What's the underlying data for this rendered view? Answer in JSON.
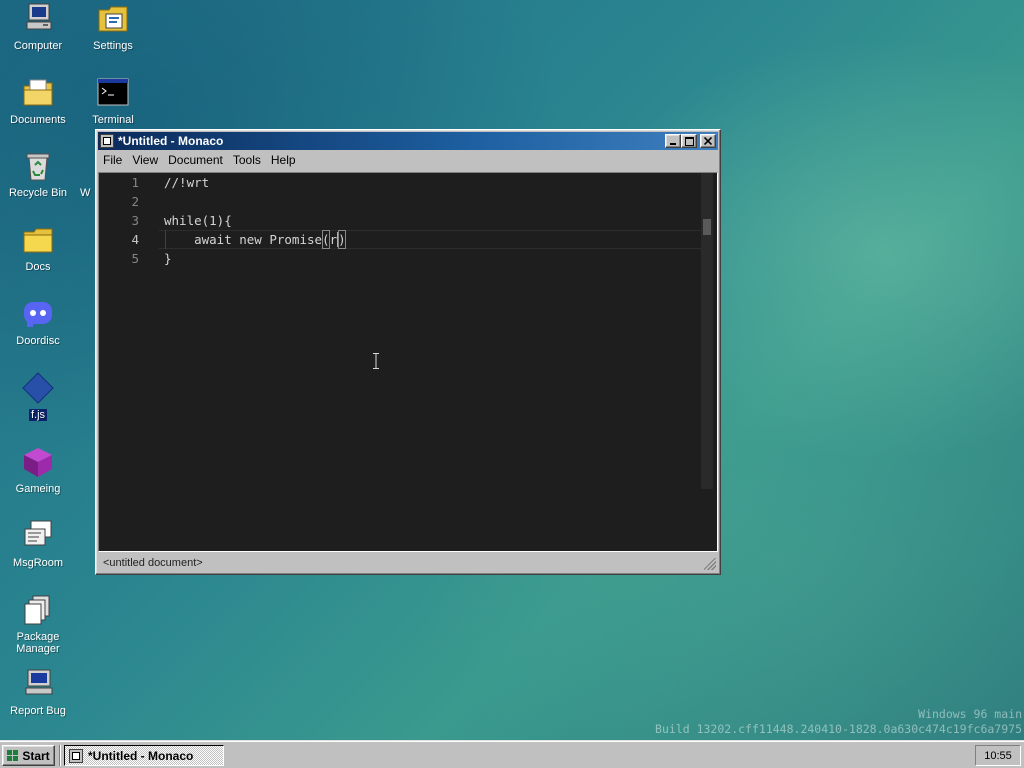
{
  "desktop": {
    "icons": [
      {
        "label": "Computer",
        "icon": "computer-icon"
      },
      {
        "label": "Settings",
        "icon": "settings-icon"
      },
      {
        "label": "Documents",
        "icon": "documents-folder-icon"
      },
      {
        "label": "Terminal",
        "icon": "terminal-icon"
      },
      {
        "label": "Recycle Bin",
        "icon": "recycle-bin-icon"
      },
      {
        "label": "Docs",
        "icon": "docs-folder-icon"
      },
      {
        "label": "Doordisc",
        "icon": "doordisc-icon"
      },
      {
        "label": "f.js",
        "icon": "fjs-diamond-icon"
      },
      {
        "label": "Gameing",
        "icon": "gameing-cube-icon"
      },
      {
        "label": "MsgRoom",
        "icon": "msgroom-icon"
      },
      {
        "label": "Package Manager",
        "icon": "package-manager-icon"
      },
      {
        "label": "Report Bug",
        "icon": "report-bug-icon"
      }
    ],
    "partial_label": "W"
  },
  "window": {
    "title": "*Untitled - Monaco",
    "menu": [
      "File",
      "View",
      "Document",
      "Tools",
      "Help"
    ],
    "editor": {
      "lines": [
        {
          "num": "1",
          "text": "//!wrt"
        },
        {
          "num": "2",
          "text": ""
        },
        {
          "num": "3",
          "text": "while(1){"
        },
        {
          "num": "4",
          "text_before": "    await new Promise",
          "bracket_open": "(",
          "cursor_char": "r",
          "bracket_close": ")"
        },
        {
          "num": "5",
          "text": "}"
        }
      ],
      "active_line": 4
    },
    "status": "<untitled document>"
  },
  "watermark": {
    "line1": "Windows 96 main",
    "line2": "Build 13202.cff11448.240410-1828.0a630c474c19fc6a7975"
  },
  "taskbar": {
    "start_label": "Start",
    "task_label": "*Untitled - Monaco",
    "clock": "10:55"
  },
  "colors": {
    "titlebar_start": "#0b2a5a",
    "titlebar_end": "#3f7fbf",
    "editor_bg": "#1e1e1e",
    "line_number": "#858585",
    "code_text": "#d4d4d4"
  }
}
